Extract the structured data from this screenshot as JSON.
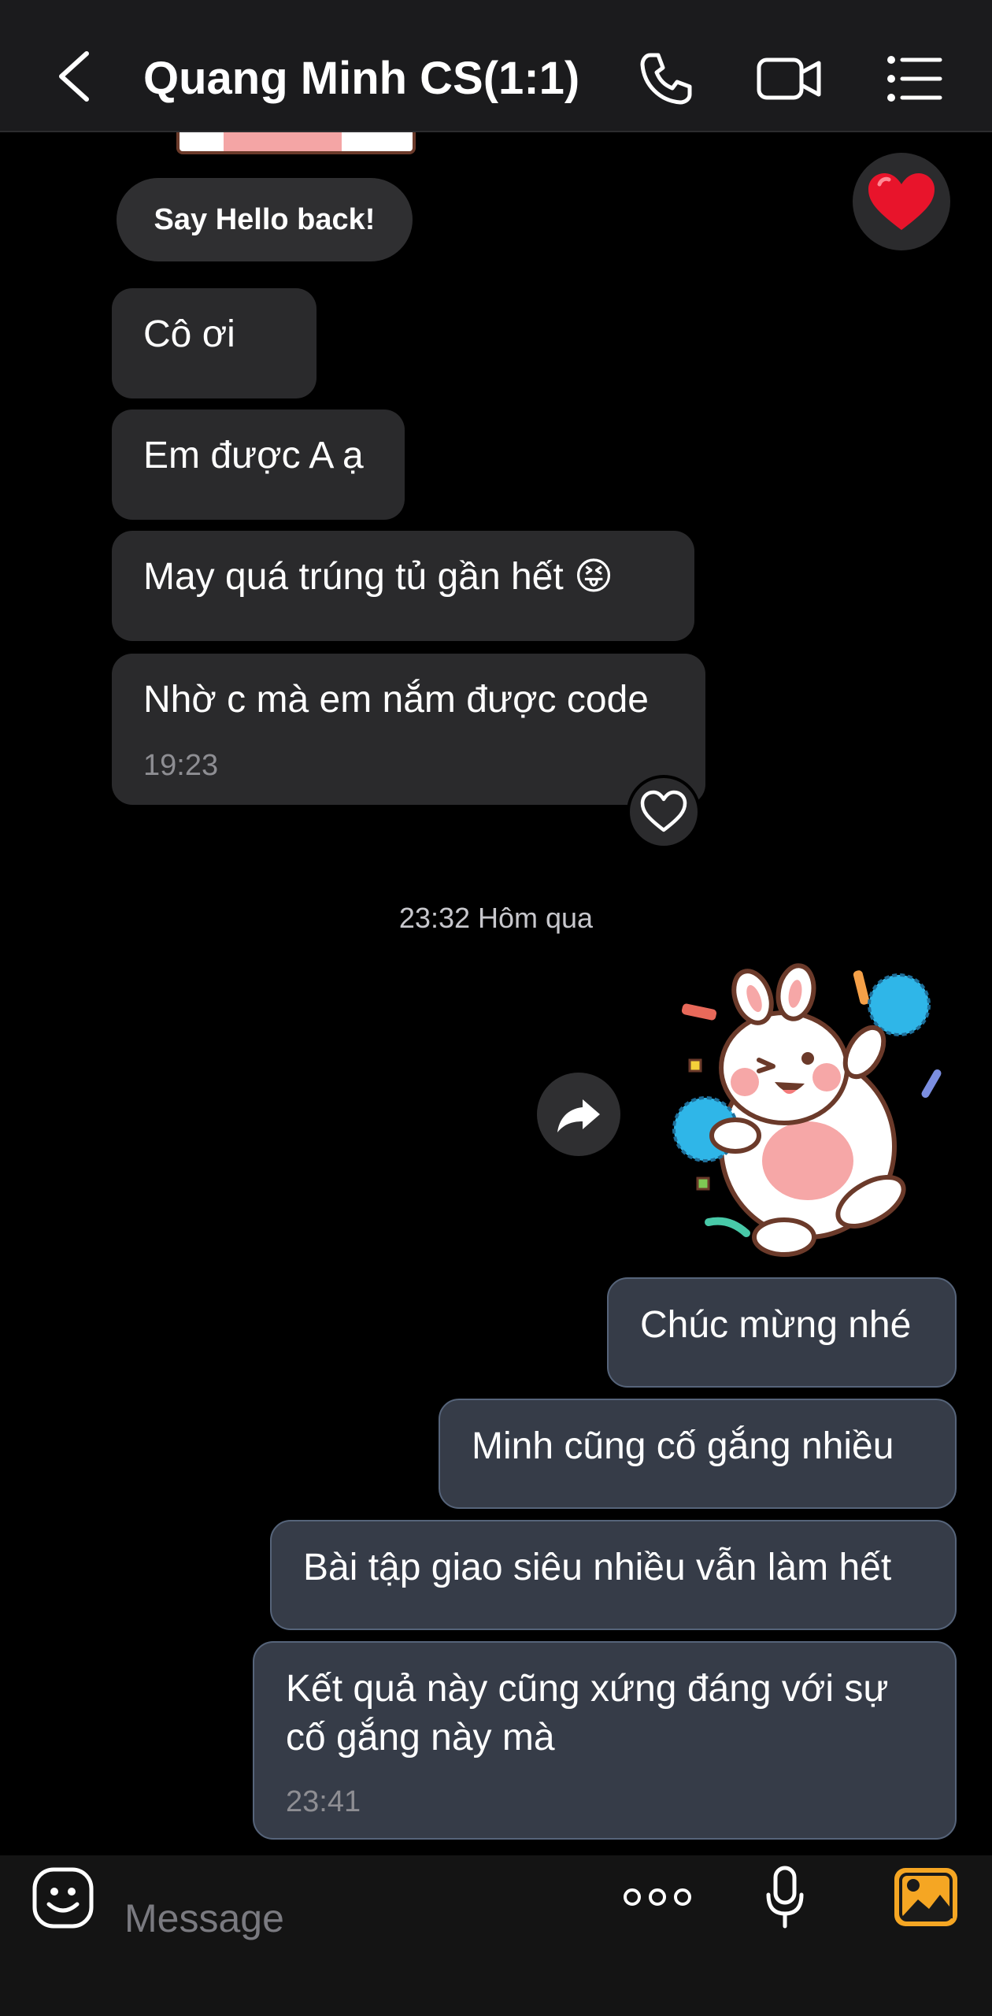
{
  "header": {
    "title": "Quang Minh CS(1:1)",
    "back_icon": "chevron-left-icon",
    "call_icon": "phone-icon",
    "video_icon": "video-camera-icon",
    "menu_icon": "list-menu-icon"
  },
  "say_hello": "Say Hello back!",
  "reaction_icon": "red-heart-icon",
  "incoming": [
    {
      "text": "Cô ơi"
    },
    {
      "text": "Em được A ạ"
    },
    {
      "text": "May quá trúng tủ gần hết 😝"
    },
    {
      "text": "Nhờ c mà em nắm được code",
      "time": "19:23"
    }
  ],
  "like_icon": "heart-outline-icon",
  "day_separator": "23:32 Hôm qua",
  "share_icon": "share-arrow-icon",
  "sticker": "cheering-bunny-sticker",
  "outgoing": [
    {
      "text": "Chúc mừng nhé"
    },
    {
      "text": "Minh cũng cố gắng nhiều"
    },
    {
      "text": "Bài tập giao siêu nhiều vẫn làm hết"
    },
    {
      "text": "Kết quả này cũng xứng đáng với sự\ncố gắng này mà",
      "time": "23:41"
    }
  ],
  "input": {
    "placeholder": "Message",
    "emoji_icon": "emoji-face-icon",
    "more_icon": "more-dots-icon",
    "mic_icon": "microphone-icon",
    "gallery_icon": "gallery-image-icon"
  },
  "colors": {
    "background": "#000000",
    "header": "#1b1b1d",
    "incoming_bubble": "#2a2a2c",
    "outgoing_bubble": "#363c48",
    "accent_orange": "#f5a623"
  }
}
